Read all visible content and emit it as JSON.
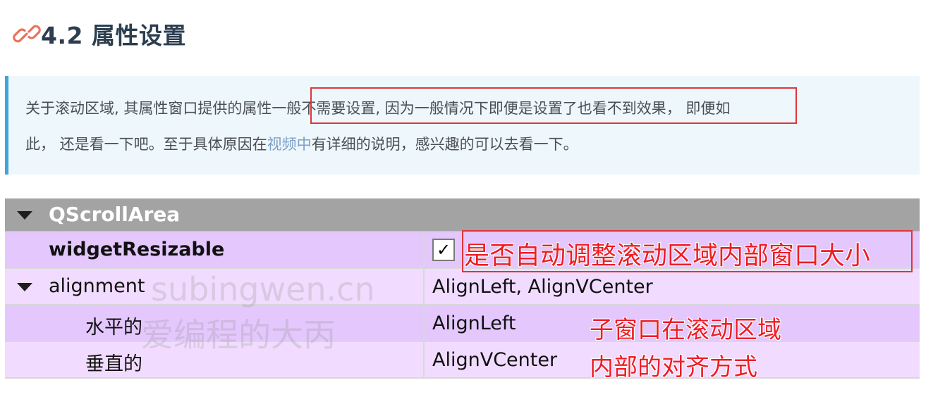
{
  "heading": {
    "text": "4.2 属性设置",
    "icon": "link-icon",
    "icon_color": "#e8735a"
  },
  "quote": {
    "line1": "关于滚动区域, 其属性窗口提供的属性一般不需要设置, 因为一般情况下即便是设置了也看不到效果，  即便如",
    "line2_before": "此，  还是看一下吧。至于具体原因在",
    "line2_link": "视频中",
    "line2_after": "有详细的说明，感兴趣的可以去看一下。",
    "accent_color": "#42a5d8",
    "highlight_color": "#e0353b"
  },
  "property_table": {
    "class_name": "QScrollArea",
    "rows": [
      {
        "name": "widgetResizable",
        "value": "",
        "checked": true,
        "checkmark": "✓"
      },
      {
        "name": "alignment",
        "value": "AlignLeft, AlignVCenter",
        "expanded": true
      },
      {
        "name": "水平的",
        "value": "AlignLeft"
      },
      {
        "name": "垂直的",
        "value": "AlignVCenter"
      }
    ],
    "header_color": "#a3a3a3",
    "row_colors": [
      "#e3c7fd",
      "#f1dcff"
    ]
  },
  "annotations": {
    "a1": "是否自动调整滚动区域内部窗口大小",
    "a2": "子窗口在滚动区域",
    "a3": "内部的对齐方式",
    "color": "#ee1d24"
  },
  "watermark": {
    "line1": "subingwen.cn",
    "line2": "爱编程的大丙"
  }
}
